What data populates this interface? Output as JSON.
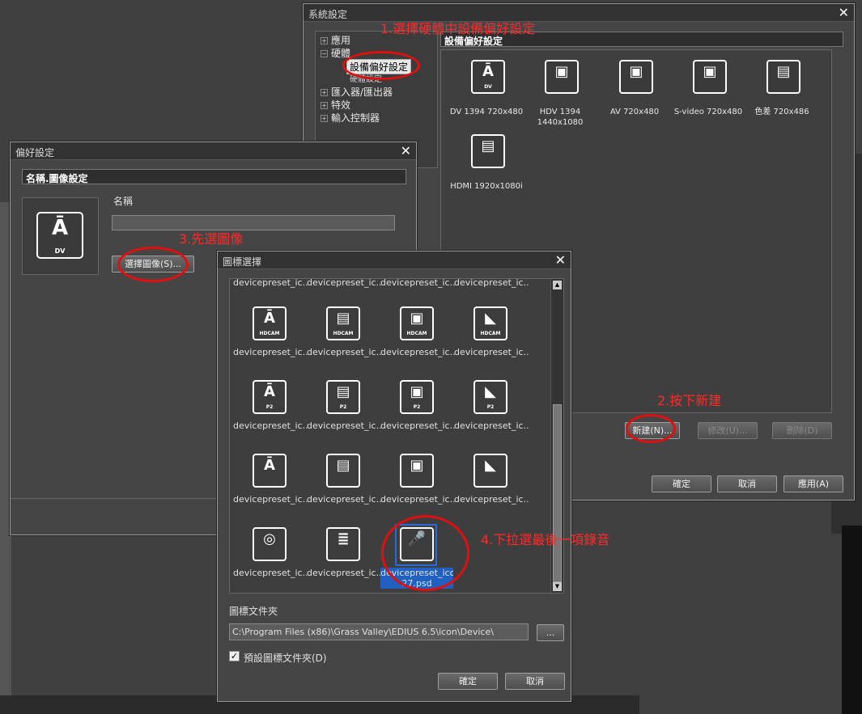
{
  "system": {
    "title": "系統設定",
    "tree": [
      "應用",
      "硬體",
      "設備偏好設定",
      "硬體設定",
      "匯入器/匯出器",
      "特效",
      "輸入控制器"
    ],
    "tree_sign": [
      "+",
      "−",
      "",
      "",
      "+",
      "+",
      "+"
    ],
    "header": "設備偏好設定",
    "presets": [
      {
        "label": "DV 1394 720x480",
        "icon": "dv-tower-icon",
        "glyph": "Ā",
        "sub": "DV"
      },
      {
        "label": "HDV 1394\n1440x1080",
        "icon": "tape-icon",
        "glyph": "▣",
        "sub": ""
      },
      {
        "label": "AV 720x480",
        "icon": "tape-icon",
        "glyph": "▣",
        "sub": ""
      },
      {
        "label": "S-video 720x480",
        "icon": "tape-icon",
        "glyph": "▣",
        "sub": ""
      },
      {
        "label": "色差 720x486",
        "icon": "deck-icon",
        "glyph": "▤",
        "sub": ""
      },
      {
        "label": "HDMI 1920x1080i",
        "icon": "deck-icon",
        "glyph": "▤",
        "sub": ""
      }
    ],
    "new_btn": "新建(N)...",
    "modify_btn": "修改(U)...",
    "delete_btn": "刪除(D)",
    "ok_btn": "確定",
    "cancel_btn": "取消",
    "apply_btn": "應用(A)"
  },
  "pref": {
    "title": "偏好設定",
    "header": "名稱.圖像設定",
    "name_label": "名稱",
    "name_value": "",
    "icon_sub": "DV",
    "select_btn": "選擇圖像(S)..."
  },
  "iconsel": {
    "title": "圖標選擇",
    "top_labels": [
      "devicepreset_ic...",
      "devicepreset_ic...",
      "devicepreset_ic...",
      "devicepreset_ic..."
    ],
    "rows": [
      [
        {
          "icon": "dv-tower-icon",
          "glyph": "Ā",
          "sub": "HDCAM",
          "label": "devicepreset_ic..."
        },
        {
          "icon": "deck-icon",
          "glyph": "▤",
          "sub": "HDCAM",
          "label": "devicepreset_ic..."
        },
        {
          "icon": "tape-icon",
          "glyph": "▣",
          "sub": "HDCAM",
          "label": "devicepreset_ic..."
        },
        {
          "icon": "camera-icon",
          "glyph": "◣",
          "sub": "HDCAM",
          "label": "devicepreset_ic..."
        }
      ],
      [
        {
          "icon": "dv-tower-icon",
          "glyph": "Ā",
          "sub": "P2",
          "label": "devicepreset_ic..."
        },
        {
          "icon": "deck-icon",
          "glyph": "▤",
          "sub": "P2",
          "label": "devicepreset_ic..."
        },
        {
          "icon": "tape-icon",
          "glyph": "▣",
          "sub": "P2",
          "label": "devicepreset_ic..."
        },
        {
          "icon": "camera-icon",
          "glyph": "◣",
          "sub": "P2",
          "label": "devicepreset_ic..."
        }
      ],
      [
        {
          "icon": "dv-tower-icon",
          "glyph": "Ā",
          "sub": "",
          "label": "devicepreset_ic..."
        },
        {
          "icon": "deck-icon",
          "glyph": "▤",
          "sub": "",
          "label": "devicepreset_ic..."
        },
        {
          "icon": "tape-icon",
          "glyph": "▣",
          "sub": "",
          "label": "devicepreset_ic..."
        },
        {
          "icon": "camera-icon",
          "glyph": "◣",
          "sub": "",
          "label": "devicepreset_ic..."
        }
      ],
      [
        {
          "icon": "webcam-icon",
          "glyph": "◎",
          "sub": "",
          "label": "devicepreset_ic..."
        },
        {
          "icon": "server-icon",
          "glyph": "≣",
          "sub": "",
          "label": "devicepreset_ic..."
        },
        {
          "icon": "microphone-icon",
          "glyph": "🎤",
          "sub": "",
          "label": "devicepreset_icon\n27.psd"
        }
      ]
    ],
    "folder_label": "圖標文件夾",
    "folder_path": "C:\\Program Files (x86)\\Grass Valley\\EDIUS 6.5\\icon\\Device\\",
    "browse_btn": "...",
    "default_folder": "預設圖標文件夾(D)",
    "ok_btn": "確定",
    "cancel_btn": "取消"
  },
  "annotations": {
    "a1": "1.選擇硬體中設備偏好設定",
    "a2": "2.按下新建",
    "a3": "3.先選圖像",
    "a4": "4.下拉選最後一項錄音"
  },
  "colors": {
    "annotation": "#ff2a2a",
    "selection": "#2060c0"
  }
}
